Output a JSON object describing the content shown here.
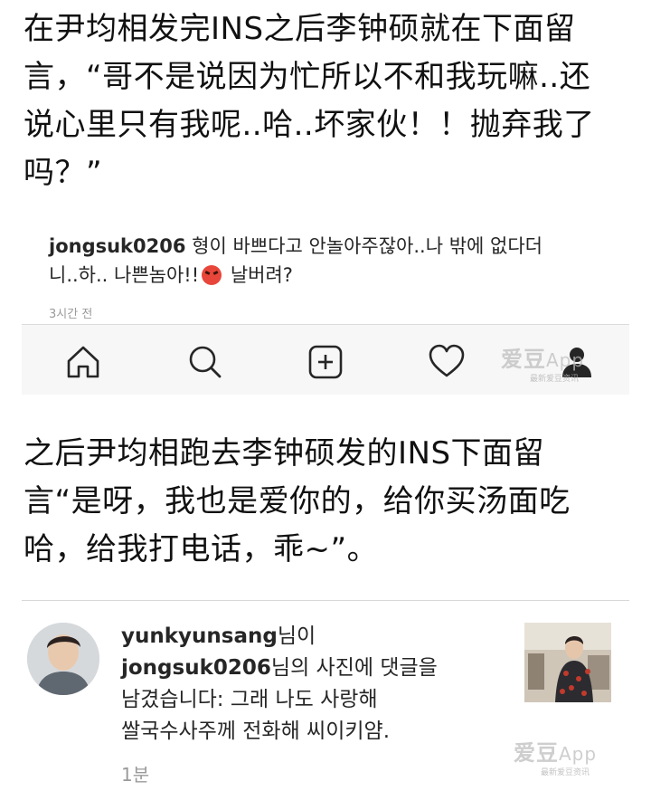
{
  "article": {
    "para1_lines": [
      "在尹均相发完INS之后李钟硕就在下面留",
      "言，“哥不是说因为忙所以不和我玩嘛..还",
      "说心里只有我呢..哈..坏家伙！！抛弃我了",
      "吗？”"
    ],
    "para2_lines": [
      "之后尹均相跑去李钟硕发的INS下面留",
      "言“是呀，我也是爱你的，给你买汤面吃",
      "哈，给我打电话，乖~”。"
    ]
  },
  "comment": {
    "username": "jongsuk0206",
    "text_line1": "형이 바쁘다고 안놀아주잖아..나 밖에 없다더",
    "text_line2_a": "니..하.. 나쁜놈아!!",
    "text_line2_b": "날버려?",
    "time": "3시간 전",
    "emoji": "angry-face"
  },
  "tabbar": {
    "icons": [
      "home-icon",
      "search-icon",
      "add-post-icon",
      "heart-icon",
      "profile-icon"
    ]
  },
  "watermark": {
    "brand": "爱豆",
    "app": "App",
    "sub": "最新爱豆资讯"
  },
  "notification": {
    "username1": "yunkyunsang",
    "suffix1": "님이",
    "username2": "jongsuk0206",
    "suffix2": "님의 사진에 댓글을",
    "line3": "남겼습니다: 그래 나도 사랑해",
    "line4": "쌀국수사주께 전화해 씨이키얌.",
    "time": "1분"
  },
  "colors": {
    "text": "#111111",
    "ig_text": "#262626",
    "muted": "#9a9a9a",
    "tabbar_bg": "#f7f7f7"
  }
}
